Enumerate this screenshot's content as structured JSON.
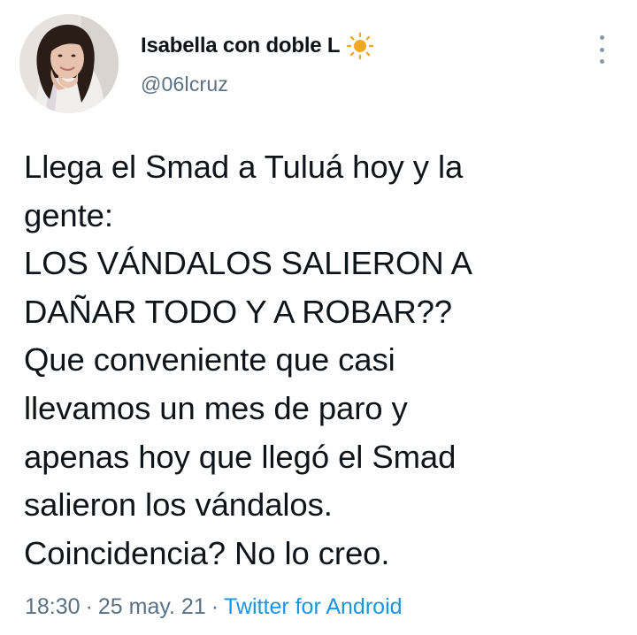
{
  "user": {
    "display_name": "Isabella con doble L",
    "handle": "@06lcruz",
    "badge_icon": "sun-icon"
  },
  "tweet": {
    "lines": [
      "Llega el Smad a Tuluá hoy y la",
      "gente:",
      "LOS VÁNDALOS SALIERON A",
      "DAÑAR TODO Y A ROBAR??",
      "Que conveniente que casi",
      "llevamos un mes de paro y",
      "apenas hoy que llegó el Smad",
      "salieron los vándalos.",
      "Coincidencia? No lo creo."
    ]
  },
  "meta": {
    "time": "18:30",
    "date": "25 may. 21",
    "source": "Twitter for Android",
    "separator": "·"
  },
  "colors": {
    "text": "#0f1419",
    "secondary": "#5b7083",
    "link": "#1b95e0",
    "sun": "#f5a623"
  }
}
